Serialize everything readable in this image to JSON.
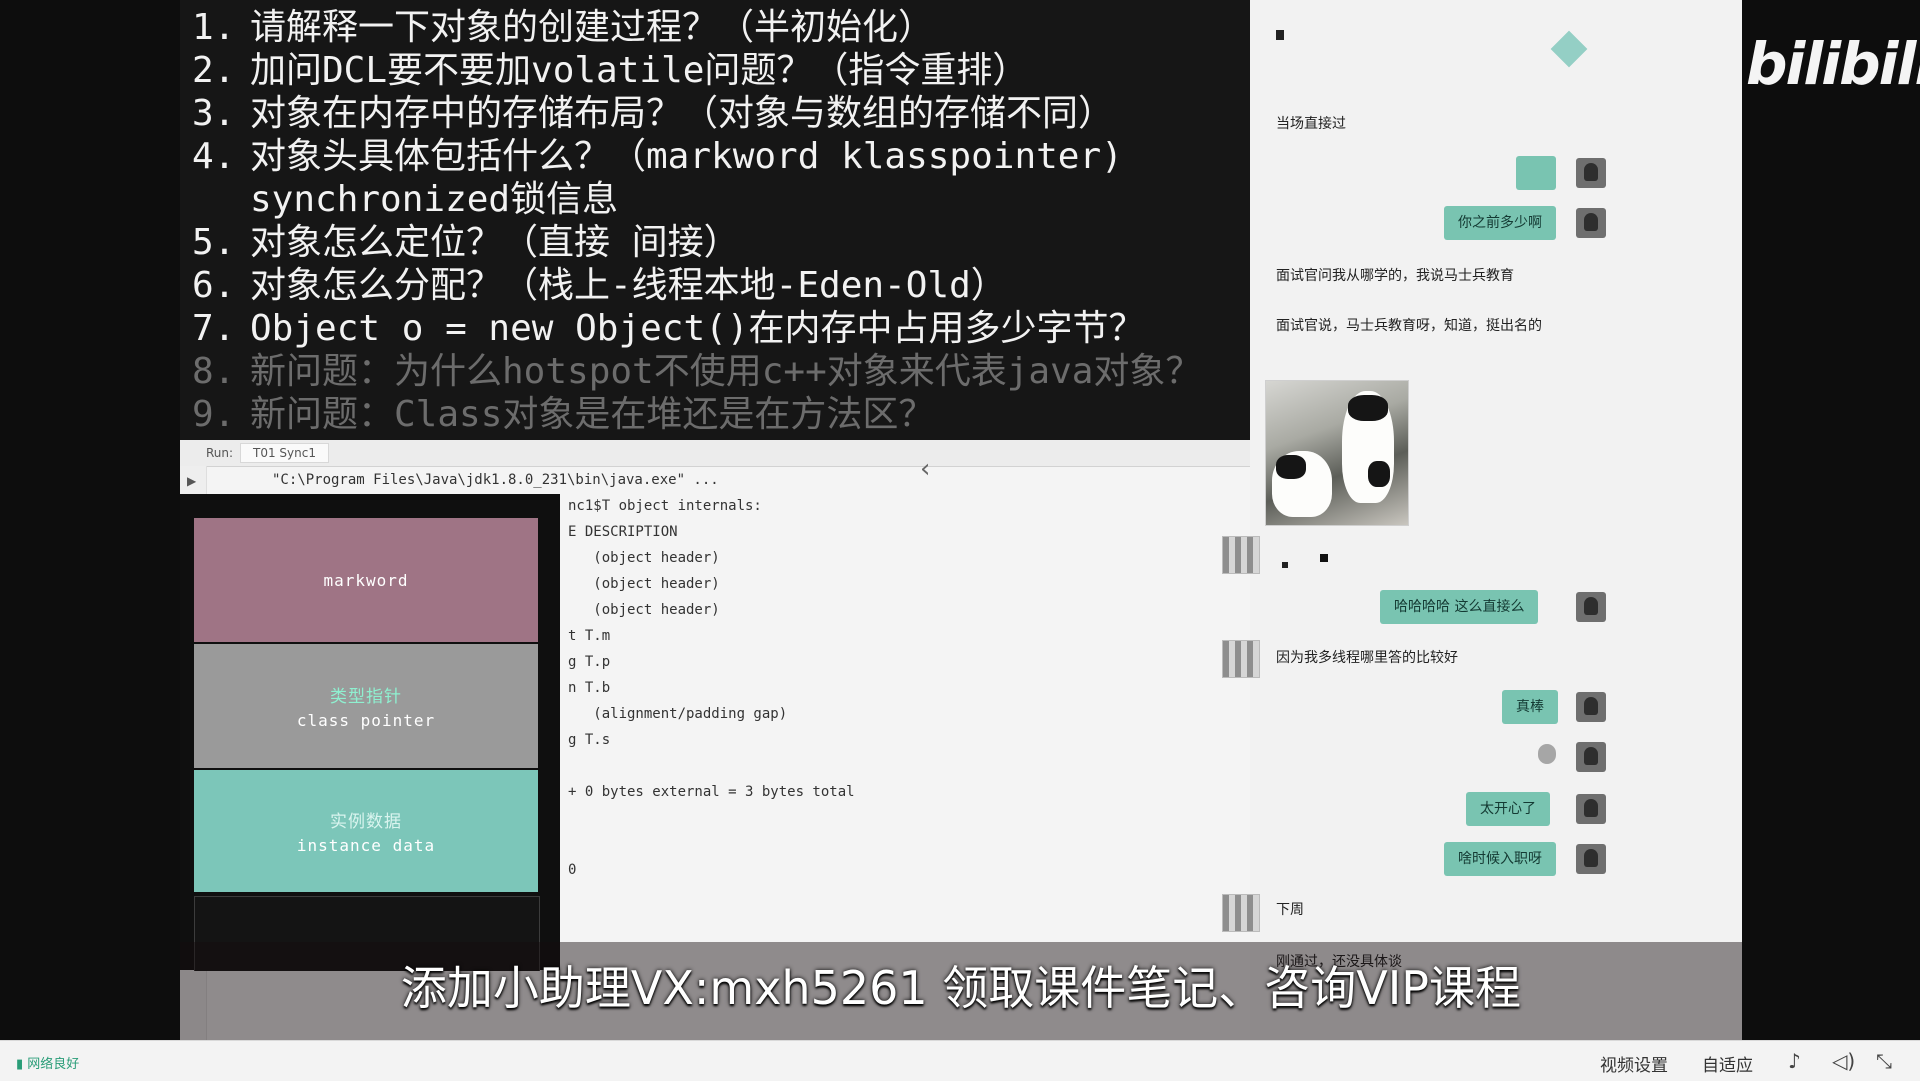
{
  "slide": {
    "questions": [
      {
        "num": "1.",
        "text": "请解释一下对象的创建过程？（半初始化）",
        "dim": false
      },
      {
        "num": "2.",
        "text": "加问DCL要不要加volatile问题？（指令重排）",
        "dim": false
      },
      {
        "num": "3.",
        "text": "对象在内存中的存储布局？（对象与数组的存储不同）",
        "dim": false
      },
      {
        "num": "4.",
        "text": "对象头具体包括什么？（markword klasspointer)",
        "dim": false
      },
      {
        "num": "",
        "text": "synchronized锁信息",
        "dim": false
      },
      {
        "num": "5.",
        "text": "对象怎么定位？（直接 间接）",
        "dim": false
      },
      {
        "num": "6.",
        "text": "对象怎么分配？（栈上-线程本地-Eden-Old）",
        "dim": false
      },
      {
        "num": "7.",
        "text": "Object o = new Object()在内存中占用多少字节？",
        "dim": false
      },
      {
        "num": "8.",
        "text": "新问题：为什么hotspot不使用c++对象来代表java对象？",
        "dim": true
      },
      {
        "num": "9.",
        "text": "新问题：Class对象是在堆还是在方法区？",
        "dim": true
      }
    ]
  },
  "ide": {
    "run_label": "Run:",
    "run_tab": "T01 Sync1",
    "console_lines": [
      "\"C:\\Program Files\\Java\\jdk1.8.0_231\\bin\\java.exe\" ...",
      "nc1$T object internals:",
      "E DESCRIPTION",
      "   (object header)",
      "   (object header)",
      "   (object header)",
      "t T.m",
      "g T.p",
      "n T.b",
      "   (alignment/padding gap)",
      "g T.s",
      "",
      "+ 0 bytes external = 3 bytes total",
      "",
      "",
      "0"
    ]
  },
  "diagram": {
    "markword": "markword",
    "class_cn": "类型指针",
    "class_en": "class pointer",
    "instance_cn": "实例数据",
    "instance_en": "instance data"
  },
  "chat": {
    "logo": "bilibili",
    "messages": [
      {
        "side": "left",
        "text": "当场直接过"
      },
      {
        "side": "right",
        "text": "你之前多少啊"
      },
      {
        "side": "left",
        "text": "面试官问我从哪学的，我说马士兵教育"
      },
      {
        "side": "left",
        "text": "面试官说，马士兵教育呀，知道，挺出名的"
      },
      {
        "side": "right",
        "text": "哈哈哈哈  这么直接么"
      },
      {
        "side": "left",
        "text": "因为我多线程哪里答的比较好"
      },
      {
        "side": "right",
        "text": "真棒"
      },
      {
        "side": "right",
        "text": "太开心了"
      },
      {
        "side": "right",
        "text": "啥时候入职呀"
      },
      {
        "side": "left",
        "text": "下周"
      },
      {
        "side": "left",
        "text": "刚通过，还没具体谈"
      }
    ]
  },
  "subtitle": "添加小助理VX:mxh5261  领取课件笔记、咨询VIP课程",
  "controls": {
    "network": "网络良好",
    "video_settings": "视频设置",
    "adaptive": "自适应"
  },
  "colors": {
    "markword": "#9f7485",
    "class_pointer": "#9a9a9a",
    "instance_data": "#7cc6b9",
    "chat_bubble": "#79c4b1"
  }
}
